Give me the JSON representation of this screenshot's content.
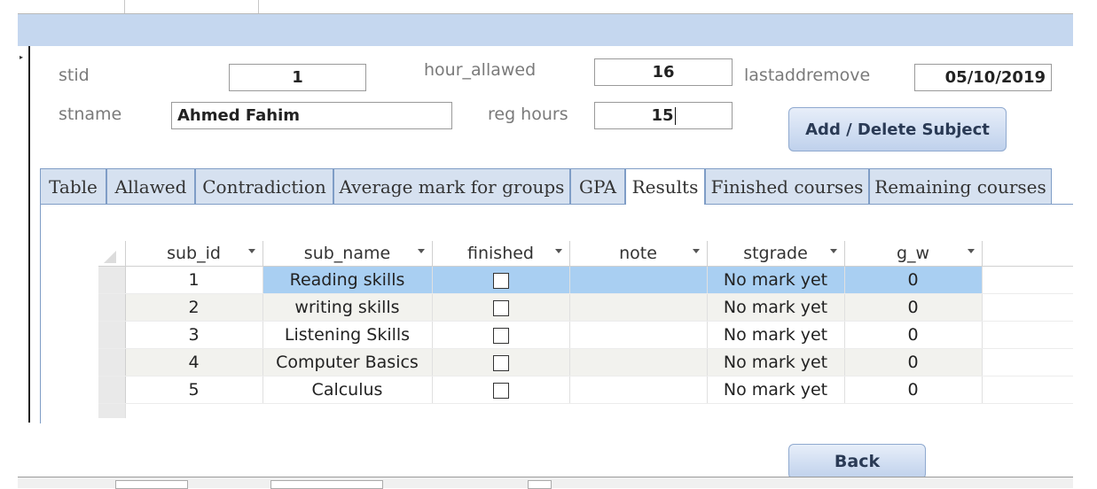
{
  "form": {
    "fields": {
      "stid": {
        "label": "stid",
        "value": "1"
      },
      "hour_allawed": {
        "label": "hour_allawed",
        "value": "16"
      },
      "lastaddremove": {
        "label": "lastaddremove",
        "value": "05/10/2019"
      },
      "stname": {
        "label": "stname",
        "value": "Ahmed Fahim"
      },
      "reg_hours": {
        "label": "reg hours",
        "value": "15"
      }
    },
    "add_delete_button": "Add / Delete Subject",
    "back_button": "Back"
  },
  "tabs": [
    {
      "label": "Table"
    },
    {
      "label": "Allawed"
    },
    {
      "label": "Contradiction"
    },
    {
      "label": "Average mark for groups"
    },
    {
      "label": "GPA"
    },
    {
      "label": "Results",
      "active": true
    },
    {
      "label": "Finished courses"
    },
    {
      "label": "Remaining courses"
    }
  ],
  "datasheet": {
    "columns": [
      "sub_id",
      "sub_name",
      "finished",
      "note",
      "stgrade",
      "g_w"
    ],
    "rows": [
      {
        "sub_id": "1",
        "sub_name": "Reading skills",
        "finished": false,
        "note": "",
        "stgrade": "No mark yet",
        "g_w": "0"
      },
      {
        "sub_id": "2",
        "sub_name": "writing skills",
        "finished": false,
        "note": "",
        "stgrade": "No mark yet",
        "g_w": "0"
      },
      {
        "sub_id": "3",
        "sub_name": "Listening Skills",
        "finished": false,
        "note": "",
        "stgrade": "No mark yet",
        "g_w": "0"
      },
      {
        "sub_id": "4",
        "sub_name": "Computer Basics",
        "finished": false,
        "note": "",
        "stgrade": "No mark yet",
        "g_w": "0"
      },
      {
        "sub_id": "5",
        "sub_name": "Calculus",
        "finished": false,
        "note": "",
        "stgrade": "No mark yet",
        "g_w": "0"
      }
    ],
    "current_row": 0
  },
  "colors": {
    "header_band": "#c5d7ef",
    "tab_bg": "#d6e1f0",
    "selected_row": "#a9cff2",
    "button": "#bfd1ec"
  }
}
